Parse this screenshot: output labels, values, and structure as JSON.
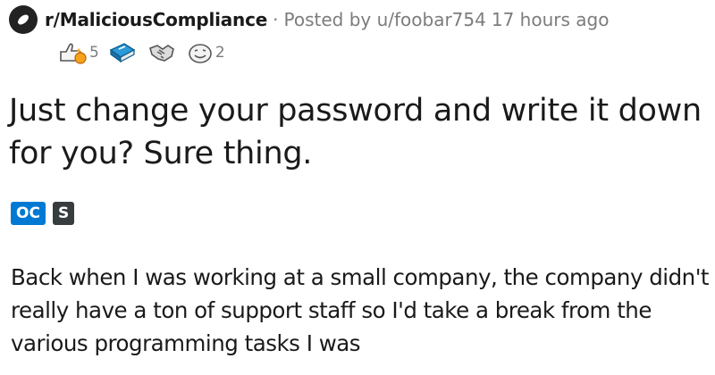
{
  "post": {
    "subreddit": "r/MaliciousCompliance",
    "separator": "·",
    "posted_by": "Posted by u/foobar754",
    "time_ago": "17 hours ago",
    "title": "Just change your password and write it down for you? Sure thing.",
    "flairs": [
      "OC",
      "S"
    ],
    "body": "Back when I was working at a small company, the company didn't really have a ton of support staff so I'd take a break from the various programming tasks I was"
  },
  "awards": [
    {
      "icon": "helpful-hand-icon",
      "count": "5"
    },
    {
      "icon": "book-award-icon",
      "count": ""
    },
    {
      "icon": "handshake-icon",
      "count": ""
    },
    {
      "icon": "smiley-face-icon",
      "count": "2"
    }
  ],
  "colors": {
    "flair_oc": "#0079d3",
    "flair_s": "#373c3f",
    "muted": "#7c7c7c",
    "text": "#1a1a1b"
  }
}
